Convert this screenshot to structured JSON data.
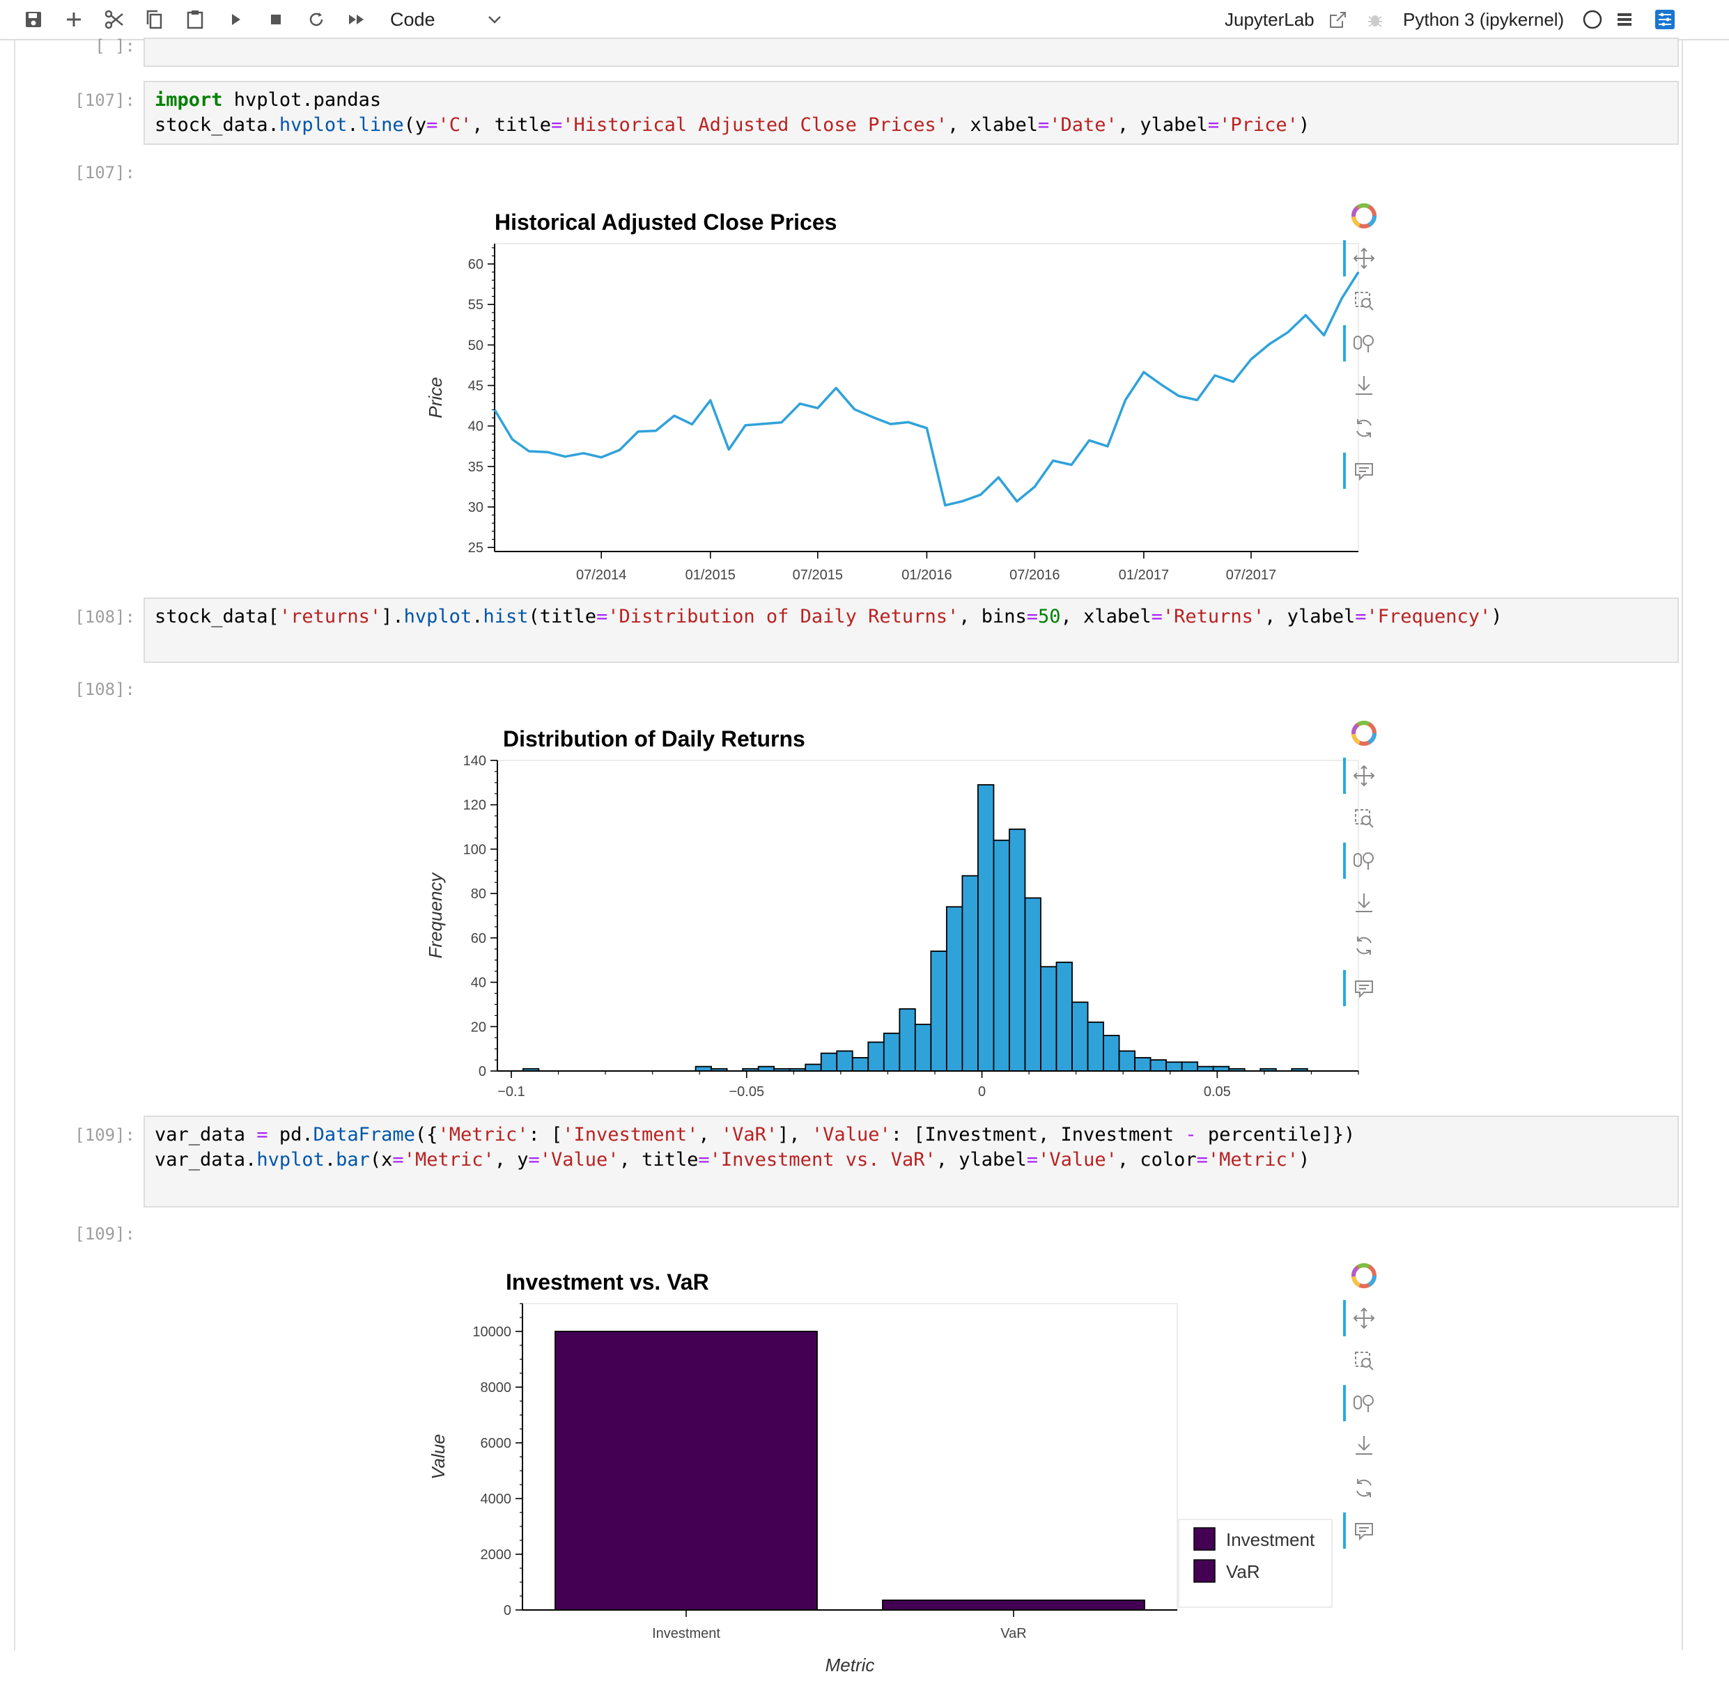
{
  "toolbar": {
    "cell_type": "Code",
    "jupyterlab_label": "JupyterLab",
    "kernel_name": "Python 3 (ipykernel)"
  },
  "cells": {
    "empty_prompt": "[ ]:",
    "c107": {
      "in_prompt": "[107]:",
      "out_prompt": "[107]:",
      "line1": {
        "kw": "import",
        "rest": " hvplot.pandas"
      },
      "line2": {
        "p1": "stock_data.",
        "a1": "hvplot",
        "p2": ".",
        "a2": "line",
        "p3": "(y",
        "o1": "=",
        "s1": "'C'",
        "p4": ", title",
        "o2": "=",
        "s2": "'Historical Adjusted Close Prices'",
        "p5": ", xlabel",
        "o3": "=",
        "s3": "'Date'",
        "p6": ", ylabel",
        "o4": "=",
        "s4": "'Price'",
        "p7": ")"
      }
    },
    "c108": {
      "in_prompt": "[108]:",
      "out_prompt": "[108]:",
      "line1": {
        "p1": "stock_data[",
        "s1": "'returns'",
        "p2": "].",
        "a1": "hvplot",
        "p3": ".",
        "a2": "hist",
        "p4": "(title",
        "o1": "=",
        "s2": "'Distribution of Daily Returns'",
        "p5": ", bins",
        "o2": "=",
        "n1": "50",
        "p6": ", xlabel",
        "o3": "=",
        "s3": "'Returns'",
        "p7": ", ylabel",
        "o4": "=",
        "s4": "'Frequency'",
        "p8": ")"
      }
    },
    "c109": {
      "in_prompt": "[109]:",
      "out_prompt": "[109]:",
      "line1": {
        "p1": "var_data ",
        "o1": "=",
        "p2": " pd.",
        "a1": "DataFrame",
        "p3": "({",
        "s1": "'Metric'",
        "p4": ": [",
        "s2": "'Investment'",
        "p5": ", ",
        "s3": "'VaR'",
        "p6": "], ",
        "s4": "'Value'",
        "p7": ": [Investment, Investment ",
        "o2": "-",
        "p8": " percentile]})"
      },
      "line2": {
        "p1": "var_data.",
        "a1": "hvplot",
        "p2": ".",
        "a2": "bar",
        "p3": "(x",
        "o1": "=",
        "s1": "'Metric'",
        "p4": ", y",
        "o2": "=",
        "s2": "'Value'",
        "p5": ", title",
        "o3": "=",
        "s3": "'Investment vs. VaR'",
        "p6": ", ylabel",
        "o4": "=",
        "s4": "'Value'",
        "p7": ", color",
        "o5": "=",
        "s5": "'Metric'",
        "p8": ")"
      }
    }
  },
  "chart_data": [
    {
      "type": "line",
      "title": "Historical Adjusted Close Prices",
      "xlabel": "Date",
      "ylabel": "Price",
      "color": "#30a2da",
      "ylim": [
        24.5,
        62.5
      ],
      "yticks": [
        25,
        30,
        35,
        40,
        45,
        50,
        55,
        60
      ],
      "xlim": [
        "2014-01-02",
        "2017-12-29"
      ],
      "xticks": [
        "07/2014",
        "01/2015",
        "07/2015",
        "01/2016",
        "07/2016",
        "01/2017",
        "07/2017"
      ],
      "x": [
        "2014-01-02",
        "2014-02-01",
        "2014-03-01",
        "2014-04-01",
        "2014-05-01",
        "2014-06-01",
        "2014-07-01",
        "2014-08-01",
        "2014-09-01",
        "2014-10-01",
        "2014-11-01",
        "2014-12-01",
        "2015-01-01",
        "2015-02-01",
        "2015-03-01",
        "2015-04-01",
        "2015-05-01",
        "2015-06-01",
        "2015-07-01",
        "2015-08-01",
        "2015-09-01",
        "2015-10-01",
        "2015-11-01",
        "2015-12-01",
        "2016-01-01",
        "2016-02-01",
        "2016-03-01",
        "2016-04-01",
        "2016-05-01",
        "2016-06-01",
        "2016-07-01",
        "2016-08-01",
        "2016-09-01",
        "2016-10-01",
        "2016-11-01",
        "2016-12-01",
        "2017-01-01",
        "2017-02-01",
        "2017-03-01",
        "2017-04-01",
        "2017-05-01",
        "2017-06-01",
        "2017-07-01",
        "2017-08-01",
        "2017-09-01",
        "2017-10-01",
        "2017-11-01",
        "2017-12-01",
        "2017-12-29"
      ],
      "y": [
        42,
        38,
        37.5,
        36,
        37,
        36,
        36.5,
        37,
        39,
        40,
        40.5,
        41,
        42.5,
        37.5,
        40,
        40,
        41,
        42,
        43,
        44,
        42.5,
        41,
        40,
        41,
        39,
        31,
        30,
        32,
        33.5,
        30.5,
        33,
        35,
        36,
        37.5,
        38,
        43,
        46.5,
        45.5,
        43,
        44,
        45.5,
        46,
        48,
        50,
        52,
        53,
        52,
        55,
        59
      ]
    },
    {
      "type": "bar",
      "title": "Distribution of Daily Returns",
      "xlabel": "Returns",
      "ylabel": "Frequency",
      "color": "#30a2da",
      "bins": 50,
      "xlim": [
        -0.1,
        0.08
      ],
      "ylim": [
        0,
        140
      ],
      "xticks": [
        -0.1,
        -0.05,
        0,
        0.05
      ],
      "xtick_labels": [
        "−0.1",
        "−0.05",
        "0",
        "0.05"
      ],
      "yticks": [
        0,
        20,
        40,
        60,
        80,
        100,
        120,
        140
      ],
      "bin_start": -0.0975,
      "bin_width": 0.0033333,
      "values": [
        1,
        0,
        0,
        0,
        0,
        0,
        0,
        0,
        0,
        0,
        0,
        2,
        1,
        0,
        1,
        2,
        1,
        1,
        3,
        8,
        9,
        6,
        13,
        17,
        28,
        21,
        54,
        74,
        88,
        129,
        104,
        109,
        78,
        47,
        49,
        31,
        22,
        16,
        9,
        6,
        5,
        4,
        4,
        2,
        2,
        1,
        0,
        1,
        0,
        1
      ]
    },
    {
      "type": "bar",
      "title": "Investment vs. VaR",
      "xlabel": "Metric",
      "ylabel": "Value",
      "categories": [
        "Investment",
        "VaR"
      ],
      "values": [
        10000,
        350
      ],
      "ylim": [
        0,
        11000
      ],
      "yticks": [
        0,
        2000,
        4000,
        6000,
        8000,
        10000
      ],
      "colors": [
        "#440154",
        "#440154"
      ],
      "legend": [
        "Investment",
        "VaR"
      ],
      "legend_position": "right"
    }
  ]
}
